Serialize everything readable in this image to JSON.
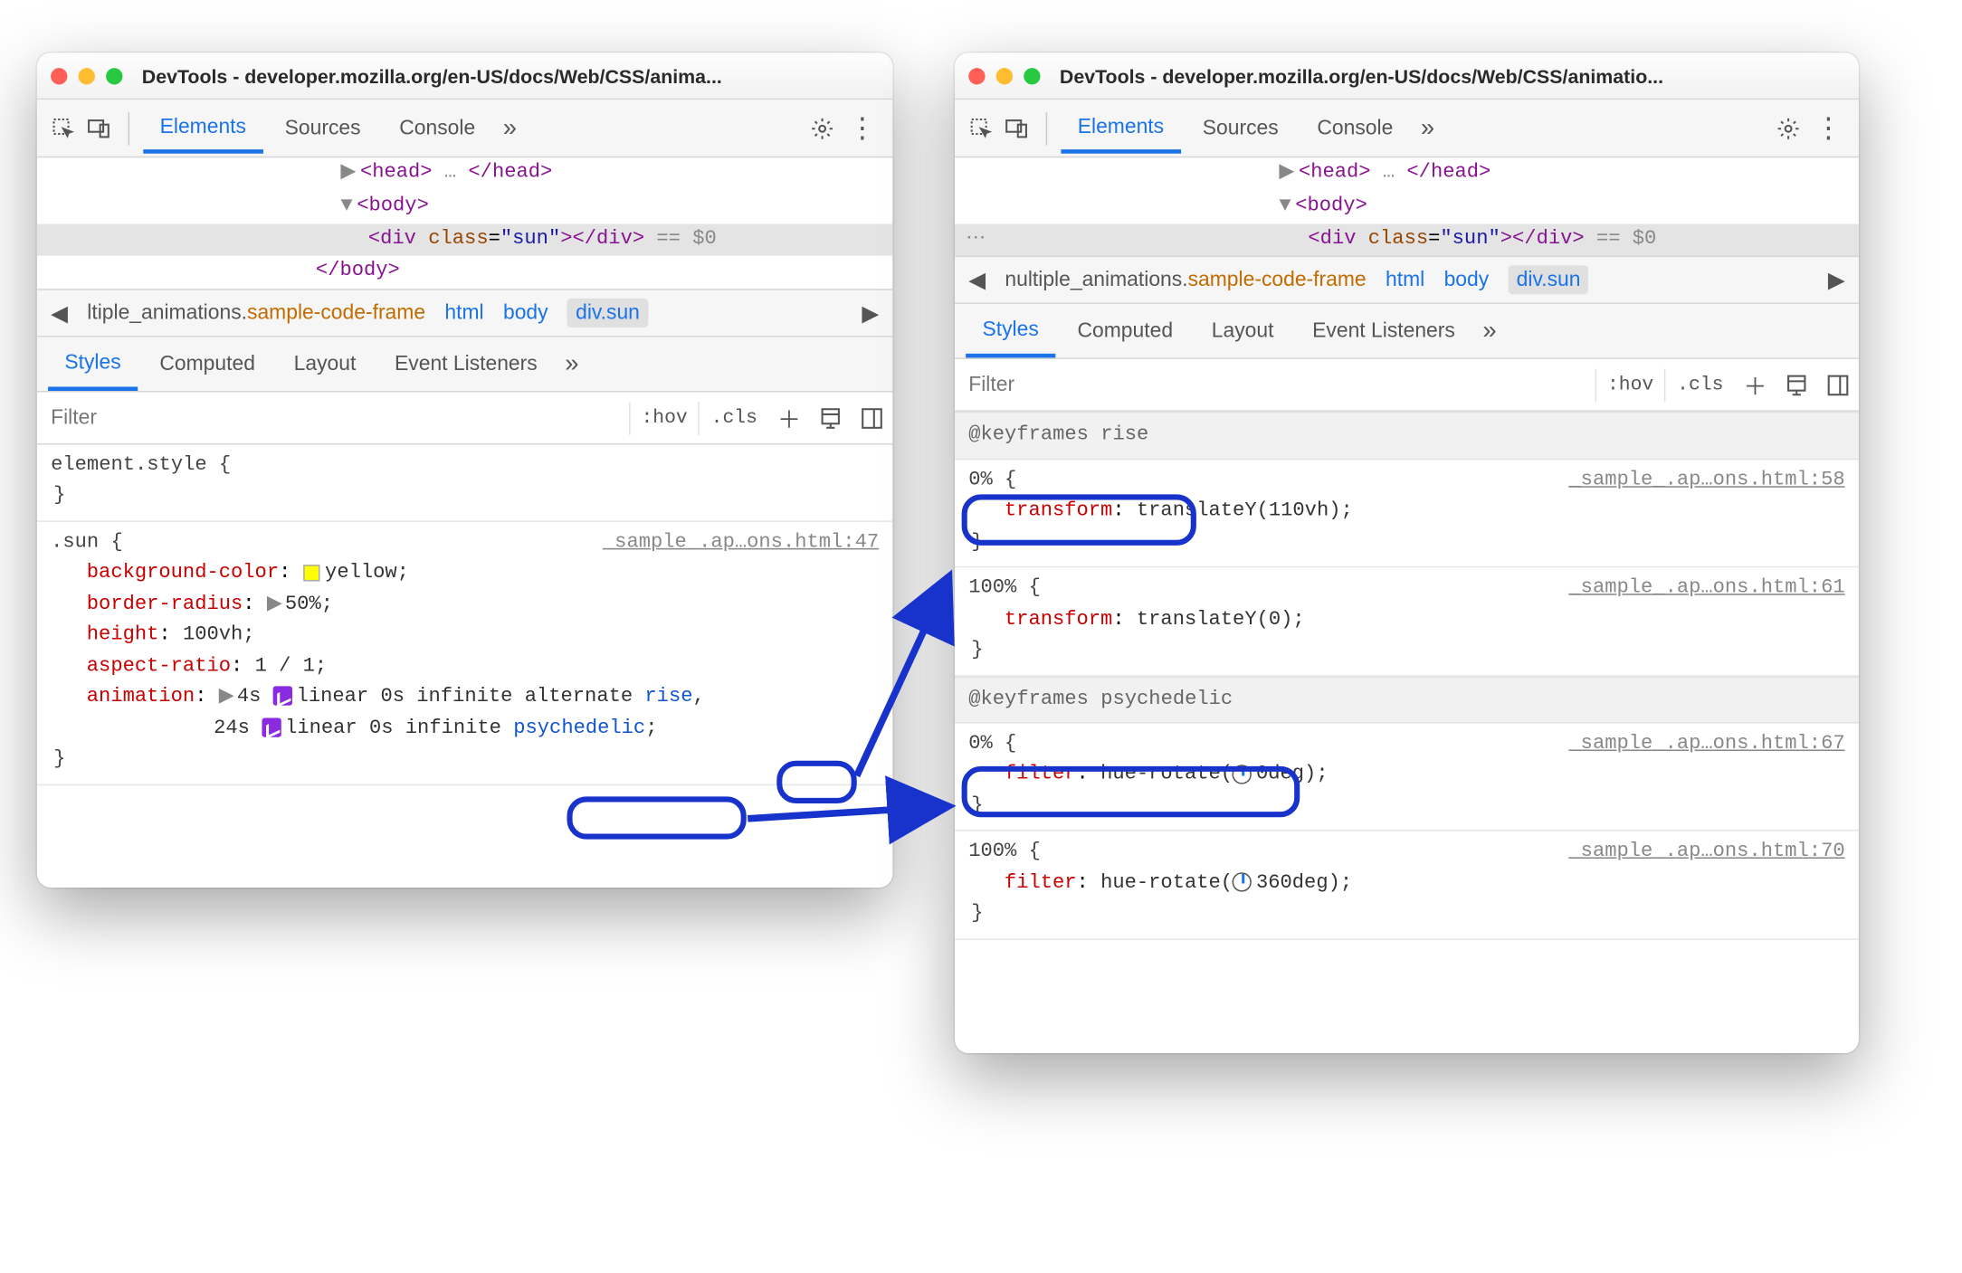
{
  "windows": {
    "left": {
      "title": "DevTools - developer.mozilla.org/en-US/docs/Web/CSS/anima...",
      "tabs": {
        "elements": "Elements",
        "sources": "Sources",
        "console": "Console"
      },
      "dom": {
        "head_open": "<head>",
        "head_ellipsis": "…",
        "head_close": "</head>",
        "body_open": "<body>",
        "div_open": "<div",
        "div_attr": "class",
        "div_val": "\"sun\"",
        "div_close_tag": "></div>",
        "eq": "== $0",
        "body_close": "</body>"
      },
      "crumbs": {
        "first_pre": "ltiple_animations.",
        "first_mid": "sample-code-frame",
        "html": "html",
        "body": "body",
        "div": "div.sun"
      },
      "tabs2": {
        "styles": "Styles",
        "computed": "Computed",
        "layout": "Layout",
        "events": "Event Listeners"
      },
      "filter": {
        "placeholder": "Filter",
        "hov": ":hov",
        "cls": ".cls"
      },
      "rules": {
        "element_style": "element.style {",
        "element_style_close": "}",
        "sun_sel": ".sun {",
        "sun_src": "_sample_.ap…ons.html:47",
        "p1": "background-color",
        "v1": "yellow;",
        "p2": "border-radius",
        "v2": "50%;",
        "p3": "height",
        "v3": "100vh;",
        "p4": "aspect-ratio",
        "v4": "1 / 1;",
        "p5": "animation",
        "v5a": "4s",
        "v5b": "linear 0s infinite alternate",
        "v5c": "rise",
        "v5d": ",",
        "v5e": "24s",
        "v5f": "linear 0s infinite",
        "v5g": "psychedelic",
        "v5h": ";",
        "close": "}"
      }
    },
    "right": {
      "title": "DevTools - developer.mozilla.org/en-US/docs/Web/CSS/animatio...",
      "tabs": {
        "elements": "Elements",
        "sources": "Sources",
        "console": "Console"
      },
      "dom": {
        "head_open": "<head>",
        "head_ellipsis": "…",
        "head_close": "</head>",
        "body_open": "<body>",
        "div_open": "<div",
        "div_attr": "class",
        "div_val": "\"sun\"",
        "div_close_tag": "></div>",
        "eq": "== $0",
        "body_close": ""
      },
      "crumbs": {
        "first_pre": "nultiple_animations.",
        "first_mid": "sample-code-frame",
        "html": "html",
        "body": "body",
        "div": "div.sun"
      },
      "tabs2": {
        "styles": "Styles",
        "computed": "Computed",
        "layout": "Layout",
        "events": "Event Listeners"
      },
      "filter": {
        "placeholder": "Filter",
        "hov": ":hov",
        "cls": ".cls"
      },
      "kf": {
        "rise_header": "@keyframes rise",
        "pct0": "0% {",
        "pct0_src": "_sample_.ap…ons.html:58",
        "p0": "transform",
        "v0": "translateY(110vh);",
        "close0": "}",
        "pct100": "100% {",
        "pct100_src": "_sample_.ap…ons.html:61",
        "p1": "transform",
        "v1": "translateY(0);",
        "close1": "}",
        "psy_header": "@keyframes psychedelic",
        "pct0b": "0% {",
        "pct0b_src": "_sample_.ap…ons.html:67",
        "p2": "filter",
        "v2a": "hue-rotate(",
        "v2b": "0deg);",
        "close2": "}",
        "pct100b": "100% {",
        "pct100b_src": "_sample_.ap…ons.html:70",
        "p3": "filter",
        "v3a": "hue-rotate(",
        "v3b": "360deg);",
        "close3": "}"
      }
    }
  }
}
